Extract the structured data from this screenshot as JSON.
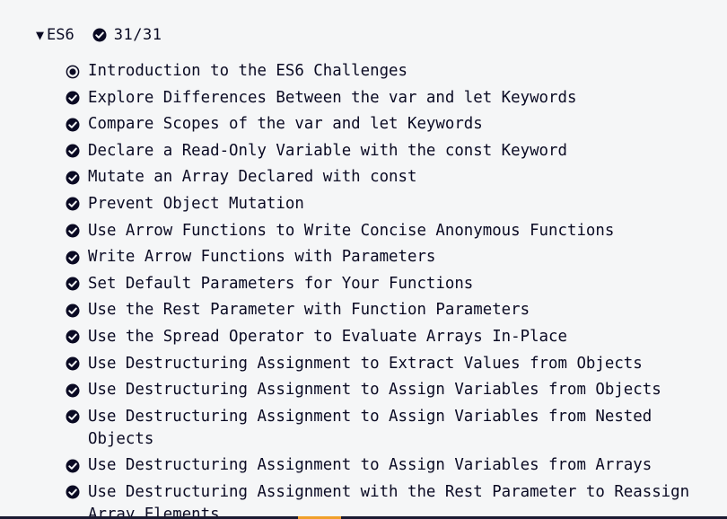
{
  "section": {
    "title": "ES6",
    "expand_icon": "triangle-down-icon",
    "completed_icon": "check-circle-icon",
    "progress": "31/31"
  },
  "colors": {
    "background": "#f5f6f7",
    "text": "#0a0a23",
    "accent": "#f1a02a",
    "bar": "#1b1b32"
  },
  "challenges": [
    {
      "label": "Introduction to the ES6 Challenges",
      "status": "current",
      "icon": "radio-selected-icon"
    },
    {
      "label": "Explore Differences Between the var and let Keywords",
      "status": "completed",
      "icon": "check-circle-icon"
    },
    {
      "label": "Compare Scopes of the var and let Keywords",
      "status": "completed",
      "icon": "check-circle-icon"
    },
    {
      "label": "Declare a Read-Only Variable with the const Keyword",
      "status": "completed",
      "icon": "check-circle-icon"
    },
    {
      "label": "Mutate an Array Declared with const",
      "status": "completed",
      "icon": "check-circle-icon"
    },
    {
      "label": "Prevent Object Mutation",
      "status": "completed",
      "icon": "check-circle-icon"
    },
    {
      "label": "Use Arrow Functions to Write Concise Anonymous Functions",
      "status": "completed",
      "icon": "check-circle-icon"
    },
    {
      "label": "Write Arrow Functions with Parameters",
      "status": "completed",
      "icon": "check-circle-icon"
    },
    {
      "label": "Set Default Parameters for Your Functions",
      "status": "completed",
      "icon": "check-circle-icon"
    },
    {
      "label": "Use the Rest Parameter with Function Parameters",
      "status": "completed",
      "icon": "check-circle-icon"
    },
    {
      "label": "Use the Spread Operator to Evaluate Arrays In-Place",
      "status": "completed",
      "icon": "check-circle-icon"
    },
    {
      "label": "Use Destructuring Assignment to Extract Values from Objects",
      "status": "completed",
      "icon": "check-circle-icon"
    },
    {
      "label": "Use Destructuring Assignment to Assign Variables from Objects",
      "status": "completed",
      "icon": "check-circle-icon"
    },
    {
      "label": "Use Destructuring Assignment to Assign Variables from Nested Objects",
      "status": "completed",
      "icon": "check-circle-icon"
    },
    {
      "label": "Use Destructuring Assignment to Assign Variables from Arrays",
      "status": "completed",
      "icon": "check-circle-icon"
    },
    {
      "label": "Use Destructuring Assignment with the Rest Parameter to Reassign Array Elements",
      "status": "completed",
      "icon": "check-circle-icon"
    }
  ]
}
